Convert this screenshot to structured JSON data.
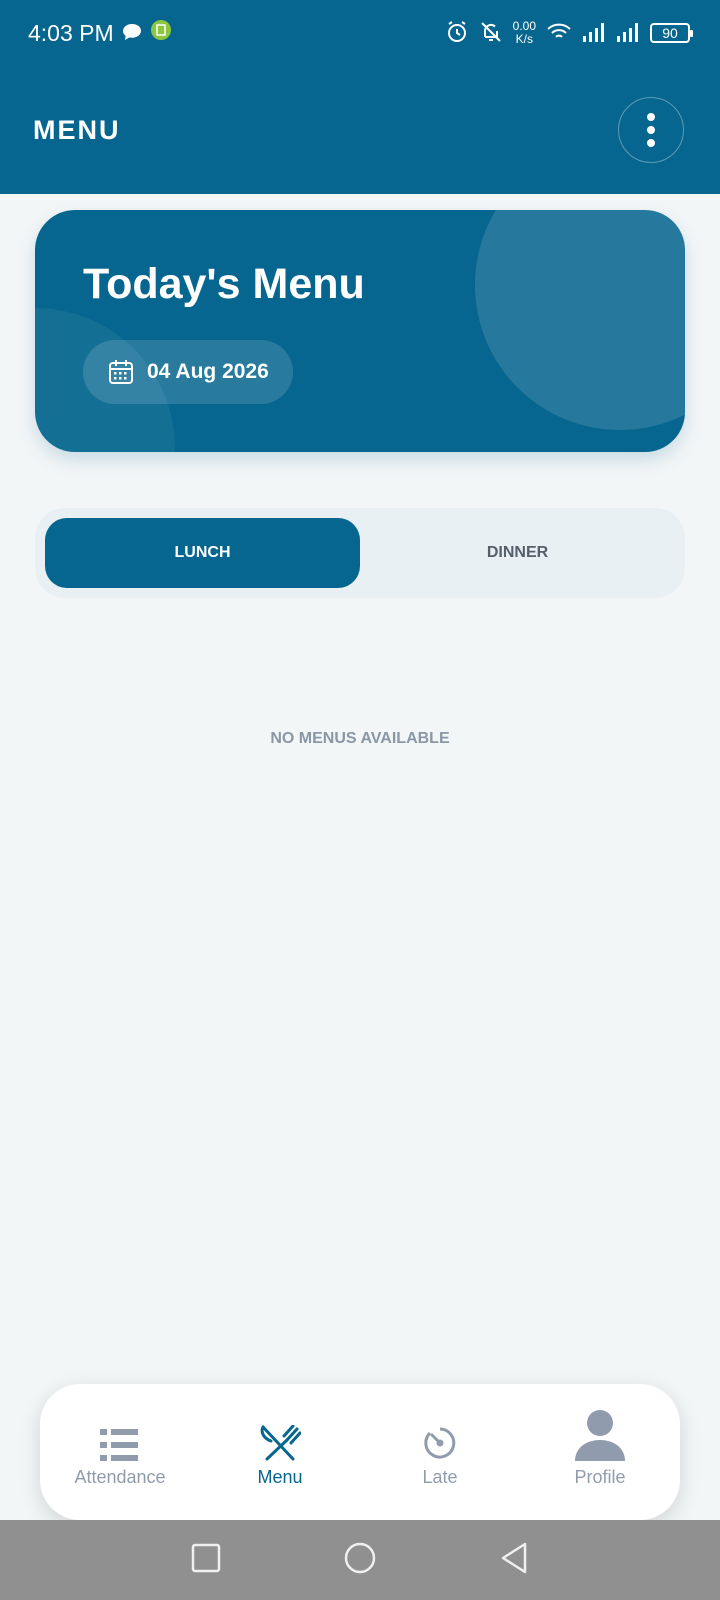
{
  "status_bar": {
    "time": "4:03 PM",
    "net_speed_value": "0.00",
    "net_speed_unit": "K/s",
    "battery": "90"
  },
  "app_bar": {
    "title": "MENU"
  },
  "hero": {
    "title": "Today's Menu",
    "date": "04 Aug 2026"
  },
  "tabs": [
    {
      "label": "LUNCH",
      "active": true
    },
    {
      "label": "DINNER",
      "active": false
    }
  ],
  "empty_message": "NO MENUS AVAILABLE",
  "bottom_nav": [
    {
      "label": "Attendance",
      "icon": "list-icon",
      "active": false
    },
    {
      "label": "Menu",
      "icon": "utensils-icon",
      "active": true
    },
    {
      "label": "Late",
      "icon": "timer-icon",
      "active": false
    },
    {
      "label": "Profile",
      "icon": "person-icon",
      "active": false
    }
  ],
  "colors": {
    "primary": "#06668f",
    "background": "#f3f6f7",
    "inactive": "#909cae"
  }
}
